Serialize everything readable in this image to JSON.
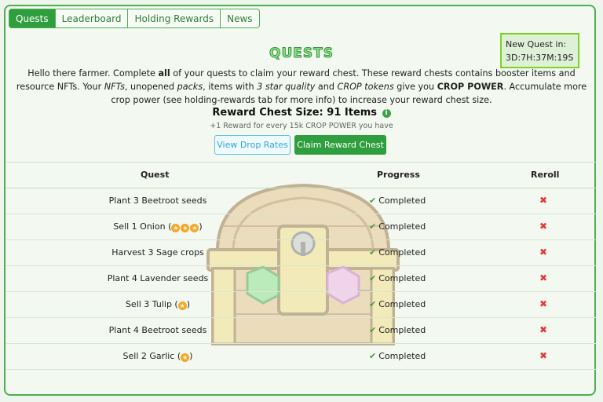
{
  "tabs": [
    "Quests",
    "Leaderboard",
    "Holding Rewards",
    "News"
  ],
  "active_tab": "Quests",
  "new_quest": {
    "label": "New Quest in:",
    "timer": "3D:7H:37M:19S"
  },
  "title": "QUESTS",
  "intro": {
    "p1": "Hello there farmer. Complete ",
    "b1": "all",
    "p2": " of your quests to claim your reward chest. These reward chests contains booster items and resource NFTs. Your ",
    "i1": "NFTs",
    "p3": ", unopened ",
    "i2": "packs",
    "p4": ", items with ",
    "i3": "3 star quality",
    "p5": " and ",
    "i4": "CROP tokens",
    "p6": " give you ",
    "b2": "CROP POWER",
    "p7": ". Accumulate more crop power (see holding-rewards tab for more info) to increase your reward chest size."
  },
  "reward": {
    "size_text": "Reward Chest Size: 91 Items",
    "info_glyph": "i",
    "note": "+1 Reward for every 15k CROP POWER you have"
  },
  "buttons": {
    "drop_rates": "View Drop Rates",
    "claim": "Claim Reward Chest"
  },
  "table": {
    "headers": [
      "Quest",
      "Progress",
      "Reroll"
    ],
    "rows": [
      {
        "quest": "Plant 3 Beetroot seeds",
        "stars": 0,
        "progress": "Completed",
        "reroll": "✖"
      },
      {
        "quest": "Sell 1 Onion",
        "stars": 3,
        "progress": "Completed",
        "reroll": "✖"
      },
      {
        "quest": "Harvest 3 Sage crops",
        "stars": 0,
        "progress": "Completed",
        "reroll": "✖"
      },
      {
        "quest": "Plant 4 Lavender seeds",
        "stars": 0,
        "progress": "Completed",
        "reroll": "✖"
      },
      {
        "quest": "Sell 3 Tulip",
        "stars": 1,
        "progress": "Completed",
        "reroll": "✖"
      },
      {
        "quest": "Plant 4 Beetroot seeds",
        "stars": 0,
        "progress": "Completed",
        "reroll": "✖"
      },
      {
        "quest": "Sell 2 Garlic",
        "stars": 1,
        "progress": "Completed",
        "reroll": "✖"
      }
    ]
  },
  "colors": {
    "accent": "#2e9e3e",
    "border": "#4caf50",
    "reroll": "#e53935",
    "star": "#f5a623"
  }
}
